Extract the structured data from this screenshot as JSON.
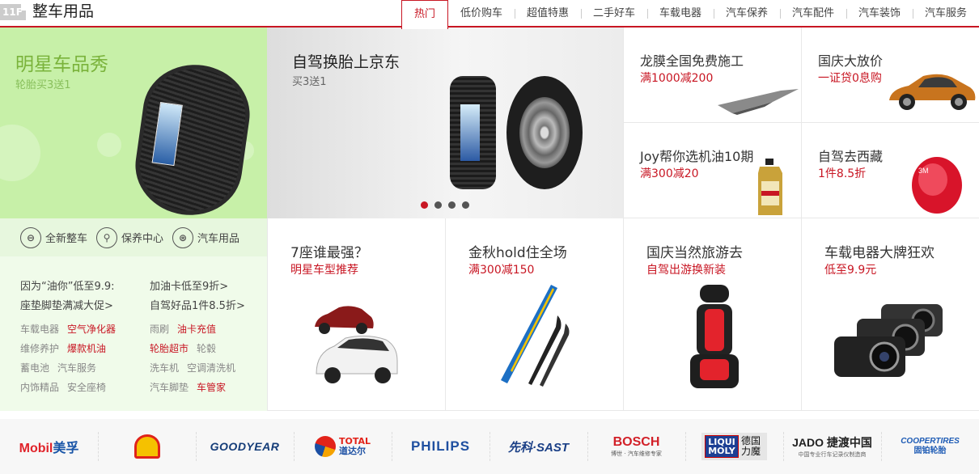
{
  "header": {
    "floor_badge": "11F",
    "title": "整车用品",
    "tabs": [
      "热门",
      "低价购车",
      "超值特惠",
      "二手好车",
      "车载电器",
      "汽车保养",
      "汽车配件",
      "汽车装饰",
      "汽车服务"
    ],
    "active_tab": 0
  },
  "left": {
    "hero_title": "明星车品秀",
    "hero_sub": "轮胎买3送1",
    "categories": [
      {
        "label": "全新整车",
        "icon": "car-icon"
      },
      {
        "label": "保养中心",
        "icon": "wrench-icon"
      },
      {
        "label": "汽车用品",
        "icon": "steering-wheel-icon"
      }
    ],
    "promo_links": [
      "因为“油你”低至9.9:",
      "加油卡低至9折>",
      "座垫脚垫满减大促>",
      "自驾好品1件8.5折>"
    ],
    "small_links": [
      {
        "label": "车载电器",
        "red": false
      },
      {
        "label": "空气净化器",
        "red": true
      },
      {
        "label": "雨刷",
        "red": false
      },
      {
        "label": "油卡充值",
        "red": true
      },
      {
        "label": "维修养护",
        "red": false
      },
      {
        "label": "爆款机油",
        "red": true
      },
      {
        "label": "轮胎超市",
        "red": true
      },
      {
        "label": "轮毂",
        "red": false
      },
      {
        "label": "蓄电池",
        "red": false
      },
      {
        "label": "汽车服务",
        "red": false
      },
      {
        "label": "洗车机",
        "red": false
      },
      {
        "label": "空调清洗机",
        "red": false
      },
      {
        "label": "内饰精品",
        "red": false
      },
      {
        "label": "安全座椅",
        "red": false
      },
      {
        "label": "汽车脚垫",
        "red": false
      },
      {
        "label": "车管家",
        "red": true
      }
    ]
  },
  "center": {
    "title": "自驾换胎上京东",
    "sub": "买3送1",
    "dots": 4,
    "active_dot": 0
  },
  "right_top": [
    {
      "title": "龙膜全国免费施工",
      "sub": "满1000减200"
    },
    {
      "title": "国庆大放价",
      "sub": "一证贷0息购"
    },
    {
      "title": "Joy帮你选机油10期",
      "sub": "满300减20"
    },
    {
      "title": "自驾去西藏",
      "sub": "1件8.5折"
    }
  ],
  "bottom_cells": [
    {
      "title": "7座谁最强？",
      "sub": "明星车型推荐"
    },
    {
      "title": "金秋hold住全场",
      "sub": "满300减150"
    },
    {
      "title": "国庆当然旅游去",
      "sub": "自驾出游换新装"
    },
    {
      "title": "车载电器大牌狂欢",
      "sub": "低至9.9元"
    }
  ],
  "brands": {
    "mobil": "Mobil",
    "mobil_cn": "美孚",
    "goodyear": "GOODYEAR",
    "total": "TOTAL",
    "total_cn": "道达尔",
    "philips": "PHILIPS",
    "sast": "先科·SAST",
    "bosch": "BOSCH",
    "bosch_sub": "博世 · 汽车维修专家",
    "liqui": "LIQUI MOLY",
    "liqui_cn": "德国力魔",
    "jado": "JADO 捷渡中国",
    "jado_sub": "中国专业行车记录仪制造商",
    "cooper": "COOPERTIRES",
    "cooper_cn": "固铂轮胎"
  },
  "colors": {
    "accent": "#c81623",
    "hero_green": "#c7f0a8",
    "left_bg": "#f0fbea"
  }
}
